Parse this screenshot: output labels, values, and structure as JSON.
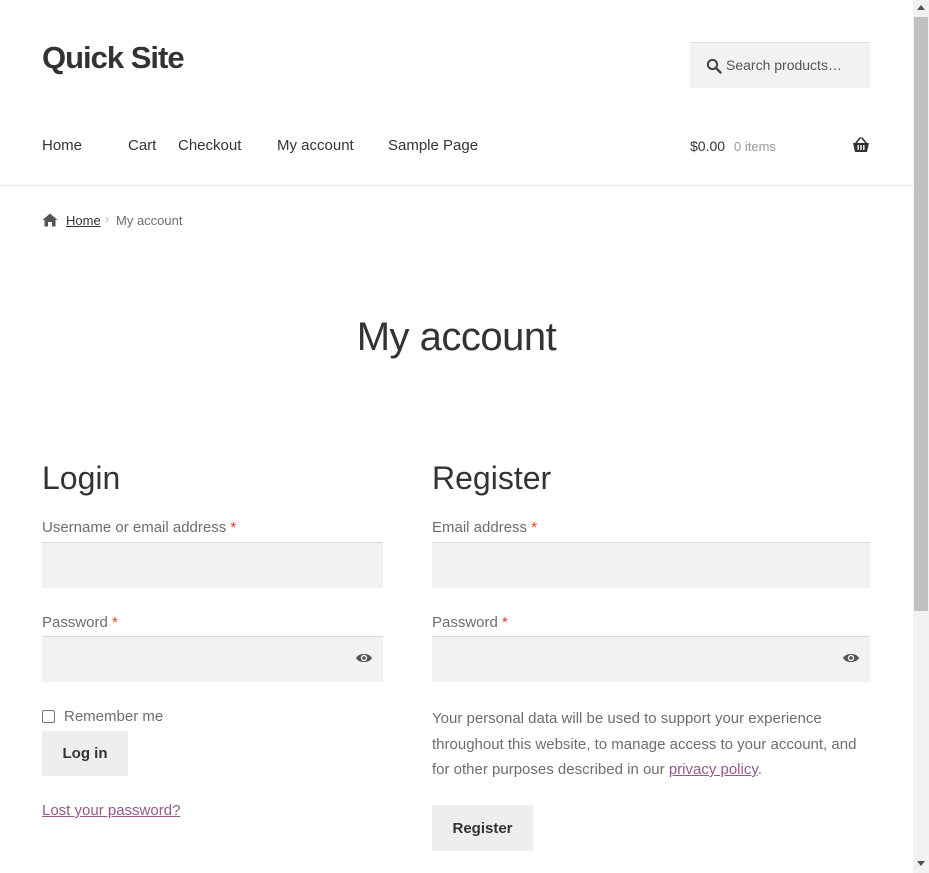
{
  "site": {
    "title": "Quick Site"
  },
  "search": {
    "placeholder": "Search products…"
  },
  "nav": {
    "items": [
      {
        "label": "Home"
      },
      {
        "label": "Cart"
      },
      {
        "label": "Checkout"
      },
      {
        "label": "My account"
      },
      {
        "label": "Sample Page"
      }
    ]
  },
  "cart": {
    "amount": "$0.00",
    "count": "0 items"
  },
  "breadcrumb": {
    "home": "Home",
    "separator": "›",
    "current": "My account"
  },
  "page": {
    "title": "My account"
  },
  "login": {
    "title": "Login",
    "username_label": "Username or email address",
    "password_label": "Password",
    "required_mark": "*",
    "remember_label": "Remember me",
    "submit_label": "Log in",
    "lost_password": "Lost your password?"
  },
  "register": {
    "title": "Register",
    "email_label": "Email address",
    "password_label": "Password",
    "required_mark": "*",
    "privacy_before": "Your personal data will be used to support your experience throughout this website, to manage access to your account, and for other purposes described in our ",
    "privacy_link": "privacy policy",
    "privacy_after": ".",
    "submit_label": "Register"
  },
  "colors": {
    "accent_link": "#96588a",
    "required": "#e2401c",
    "heading": "#333333",
    "body_text": "#6d6d6d",
    "field_bg": "#f2f2f2",
    "button_bg": "#eeeeee"
  },
  "icons": [
    "search-icon",
    "basket-icon",
    "home-icon",
    "eye-icon"
  ]
}
